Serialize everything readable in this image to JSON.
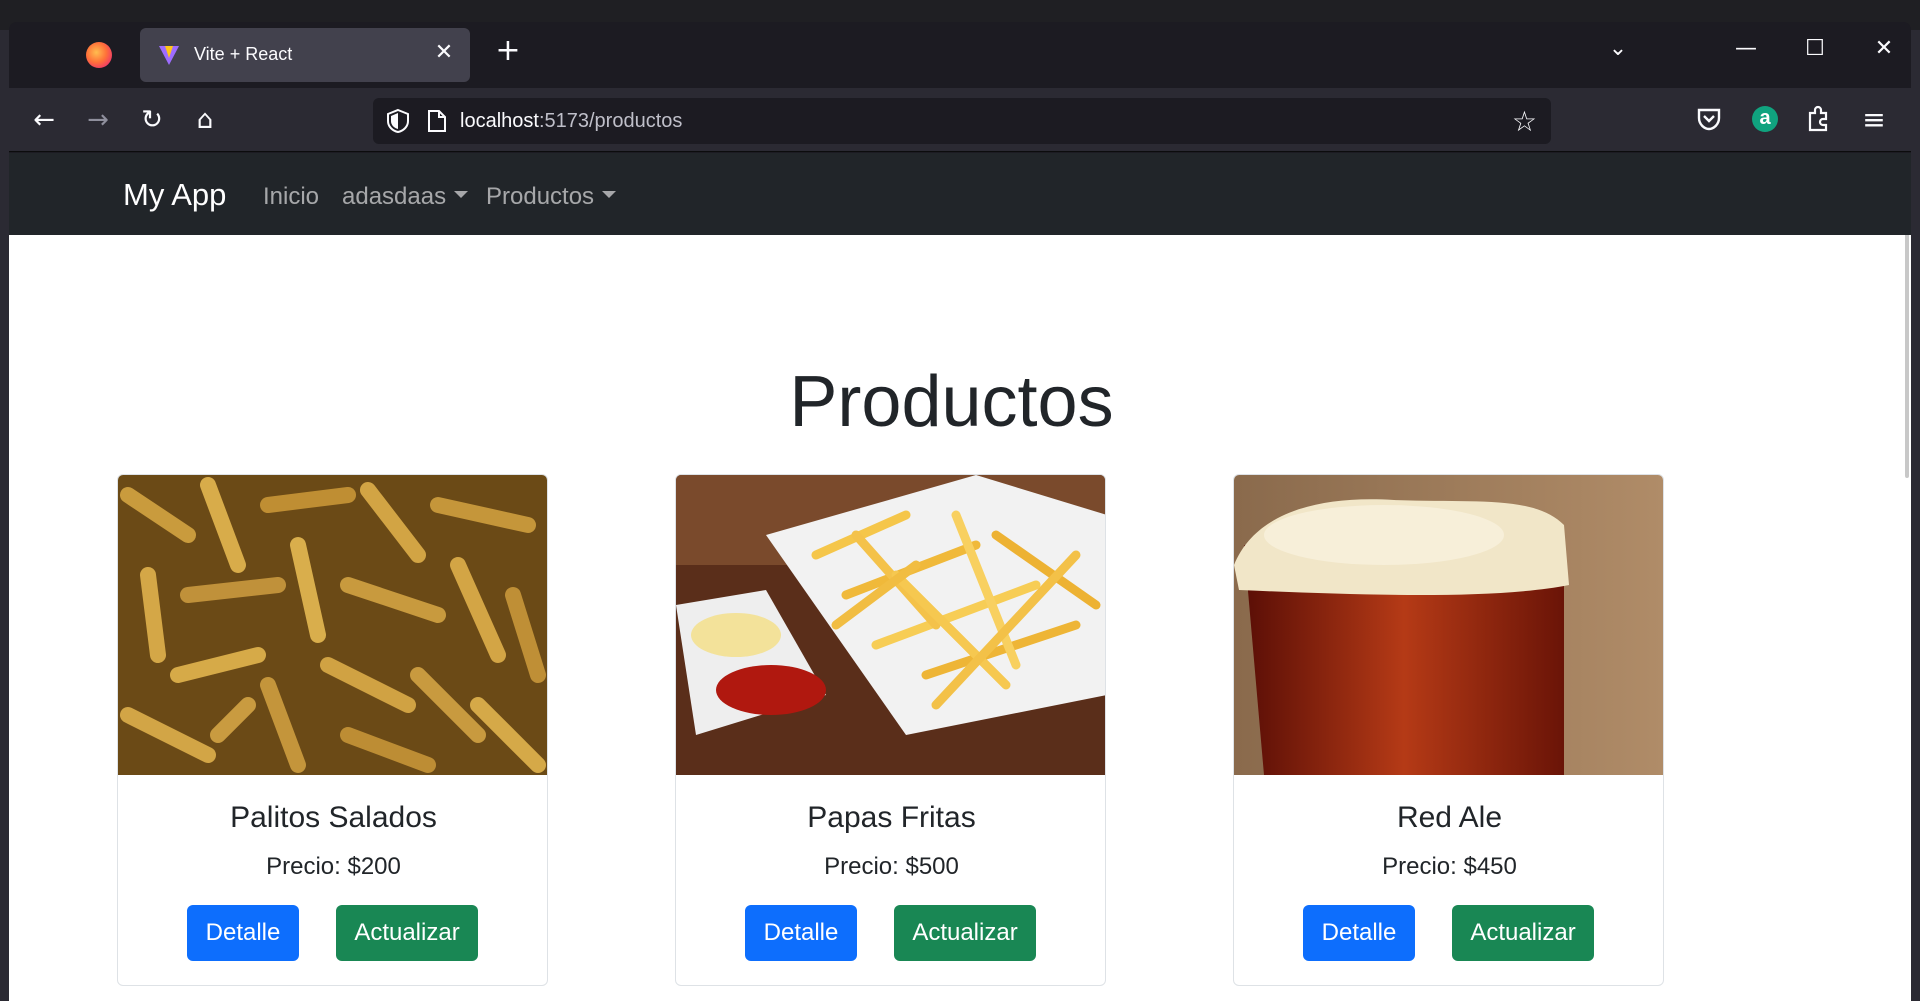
{
  "browser": {
    "tab_title": "Vite + React",
    "tab_close": "✕",
    "new_tab": "+",
    "tab_list": "⌄",
    "minimize": "—",
    "maximize": "☐",
    "close": "✕",
    "url_host": "localhost",
    "url_path": ":5173/productos",
    "back": "←",
    "forward": "→",
    "reload": "↻",
    "home": "⌂",
    "bookmark": "☆",
    "extension_letter": "a",
    "menu": "≡"
  },
  "navbar": {
    "brand": "My App",
    "links": [
      {
        "label": "Inicio",
        "dropdown": false
      },
      {
        "label": "adasdaas",
        "dropdown": true
      },
      {
        "label": "Productos",
        "dropdown": true
      }
    ]
  },
  "main": {
    "heading": "Productos",
    "products": [
      {
        "name": "Palitos Salados",
        "price": "Precio: $200",
        "detail_label": "Detalle",
        "update_label": "Actualizar",
        "image": "fried salted sticks"
      },
      {
        "name": "Papas Fritas",
        "price": "Precio: $500",
        "detail_label": "Detalle",
        "update_label": "Actualizar",
        "image": "french fries with ketchup and mayo"
      },
      {
        "name": "Red Ale",
        "price": "Precio: $450",
        "detail_label": "Detalle",
        "update_label": "Actualizar",
        "image": "glass of red ale beer"
      }
    ]
  },
  "colors": {
    "primary": "#0d6efd",
    "success": "#198754",
    "navbar_bg": "#212529"
  }
}
